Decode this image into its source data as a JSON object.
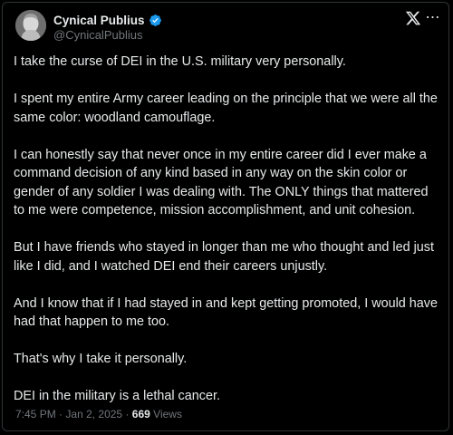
{
  "author": {
    "name": "Cynical Publius",
    "handle": "@CynicalPublius",
    "verified_color": "#1d9bf0"
  },
  "icons": {
    "avatar": "portrait-avatar-icon",
    "verified": "verified-badge-icon",
    "logo": "x-logo-icon",
    "menu": "more-options-icon"
  },
  "post": {
    "paragraphs": [
      "I take the curse of DEI in the U.S. military very personally.",
      "I spent my entire Army career leading on the principle that we were all the same color: woodland camouflage.",
      "I can honestly say that never once in my entire career did I ever make a command decision of any kind based in any way on the skin color or gender of any soldier I was dealing with.  The ONLY things that mattered to me were competence, mission accomplishment, and unit cohesion.",
      "But I have friends who stayed in longer than me who thought and led just like I did, and I watched DEI end their careers unjustly.",
      "And I know that if I had stayed in and kept getting promoted, I would have had that happen to me too.",
      "That's why I take it personally.",
      "DEI in the military is a lethal cancer."
    ]
  },
  "meta": {
    "time": "7:45 PM",
    "separator": "·",
    "date": "Jan 2, 2025",
    "views_count": "669",
    "views_label": "Views"
  }
}
